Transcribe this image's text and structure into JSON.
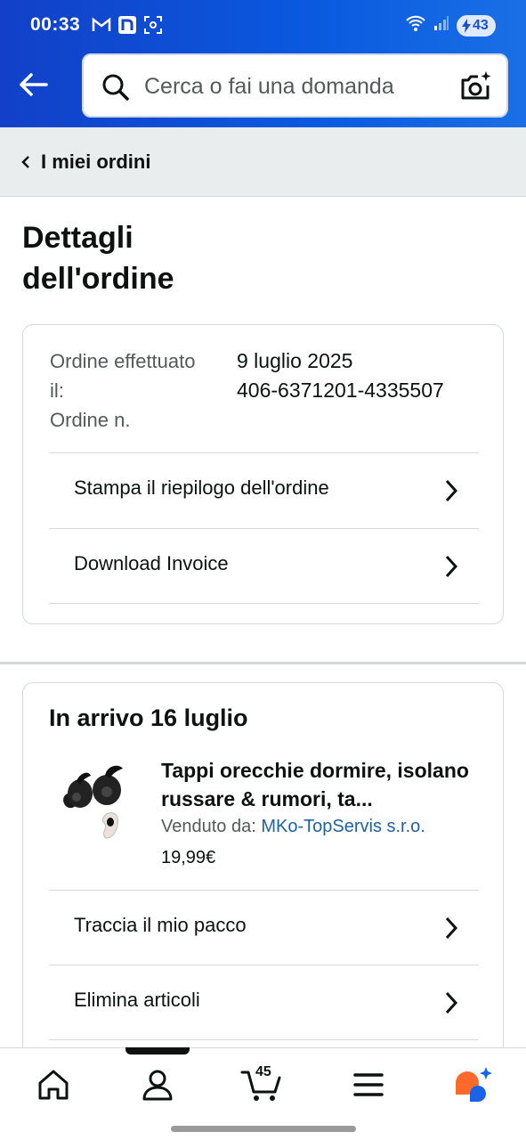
{
  "status_bar": {
    "time": "00:33",
    "battery": "43",
    "icons": [
      "gmail-icon",
      "n-app-icon",
      "screenshot-icon",
      "wifi-icon",
      "signal-icon",
      "battery-icon"
    ]
  },
  "header": {
    "search_placeholder": "Cerca o fai una domanda",
    "colors": {
      "bar": "#0a5adf",
      "accent": "#ff6a2c"
    }
  },
  "breadcrumb": {
    "label": "I miei ordini"
  },
  "page": {
    "title_line1": "Dettagli",
    "title_line2": "dell'ordine"
  },
  "order_info": {
    "placed_label": "Ordine effettuato il:",
    "placed_value": "9 luglio 2025",
    "number_label": "Ordine n.",
    "number_value": "406-6371201-4335507"
  },
  "order_actions": [
    {
      "label": "Stampa il riepilogo dell'ordine"
    },
    {
      "label": "Download Invoice"
    }
  ],
  "shipment": {
    "arrival": "In arrivo 16 luglio",
    "product_title": "Tappi orecchie dormire, isolano russare & rumori, ta...",
    "seller_label": "Venduto da:",
    "seller_name": "MKo-TopServis s.r.o.",
    "price": "19,99€",
    "actions": [
      {
        "label": "Traccia il mio pacco"
      },
      {
        "label": "Elimina articoli"
      }
    ]
  },
  "bottom_nav": {
    "items": [
      "home-icon",
      "account-icon",
      "cart-icon",
      "menu-icon",
      "assistant-icon"
    ],
    "cart_count": "45",
    "active": "account-icon"
  }
}
